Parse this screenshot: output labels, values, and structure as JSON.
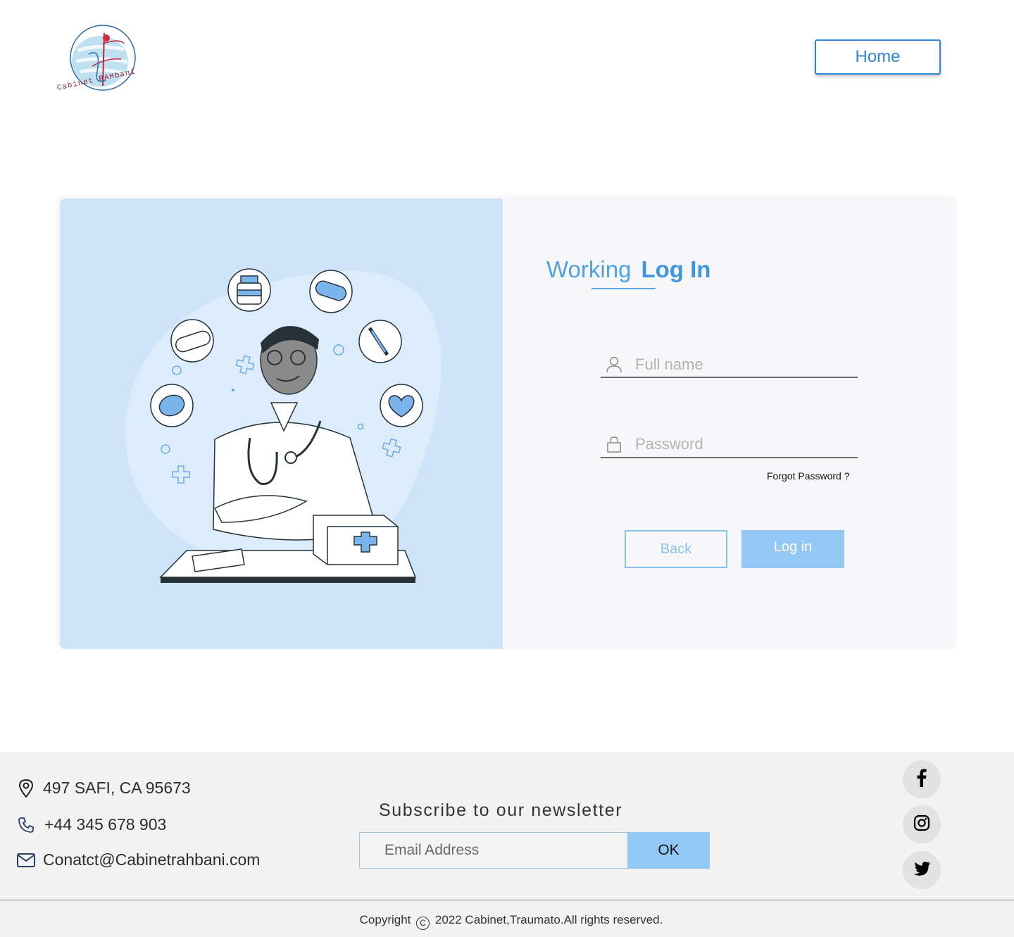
{
  "header": {
    "logo_text": "Cabinet RAHbani",
    "home_label": "Home"
  },
  "login": {
    "title_word1": "Working",
    "title_word2": "Log In",
    "fullname_placeholder": "Full name",
    "password_placeholder": "Password",
    "forgot_label": "Forgot Password ?",
    "back_label": "Back",
    "login_label": "Log in"
  },
  "footer": {
    "address": "497  SAFI, CA 95673",
    "phone": "+44 345 678 903",
    "email": "Conatct@Cabinetrahbani.com",
    "newsletter_title": "Subscribe to our newsletter",
    "email_placeholder": "Email Address",
    "ok_label": "OK",
    "social": [
      "facebook-icon",
      "instagram-icon",
      "twitter-icon"
    ],
    "copyright_prefix": "Copyright",
    "copyright_suffix": "2022 Cabinet,Traumato.All rights reserved."
  },
  "colors": {
    "accent": "#3e96e0",
    "illustration_bg": "#cee4f8",
    "button_fill": "#93c8f4",
    "footer_bg": "#f2f2f2"
  }
}
